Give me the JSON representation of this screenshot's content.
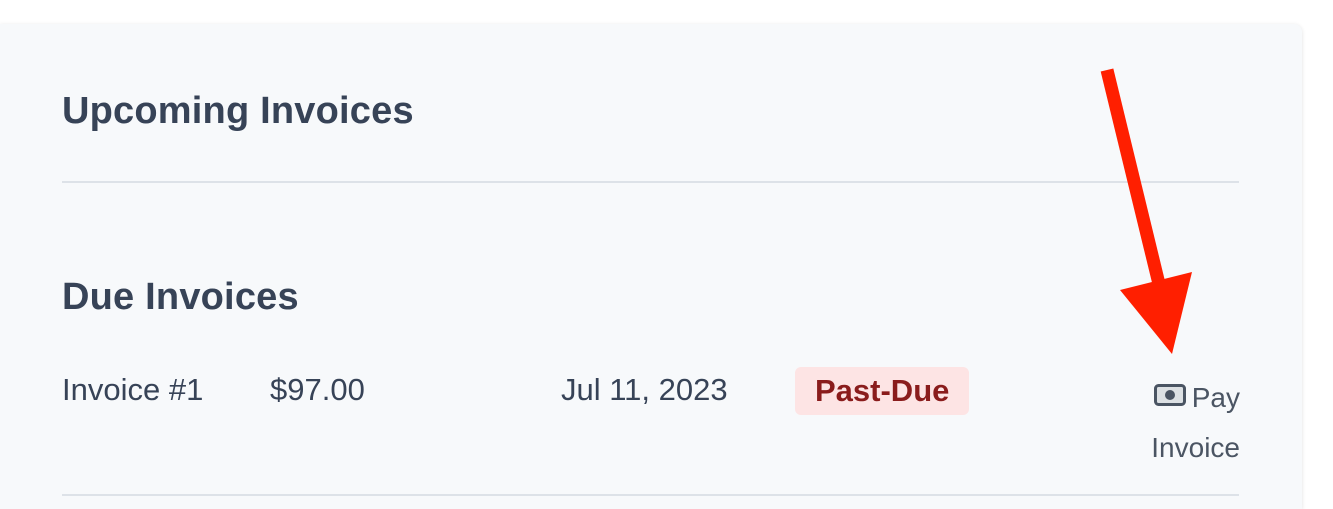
{
  "sections": {
    "upcoming_title": "Upcoming Invoices",
    "due_title": "Due Invoices"
  },
  "due_invoices": [
    {
      "name": "Invoice #1",
      "amount": "$97.00",
      "date": "Jul 11, 2023",
      "status": "Past-Due",
      "action_label": "Pay Invoice",
      "action_icon": "money-bill-icon"
    }
  ],
  "colors": {
    "status_past_due_bg": "#fde4e4",
    "status_past_due_text": "#8a1c1c",
    "annotation_arrow": "#ff1f00"
  }
}
